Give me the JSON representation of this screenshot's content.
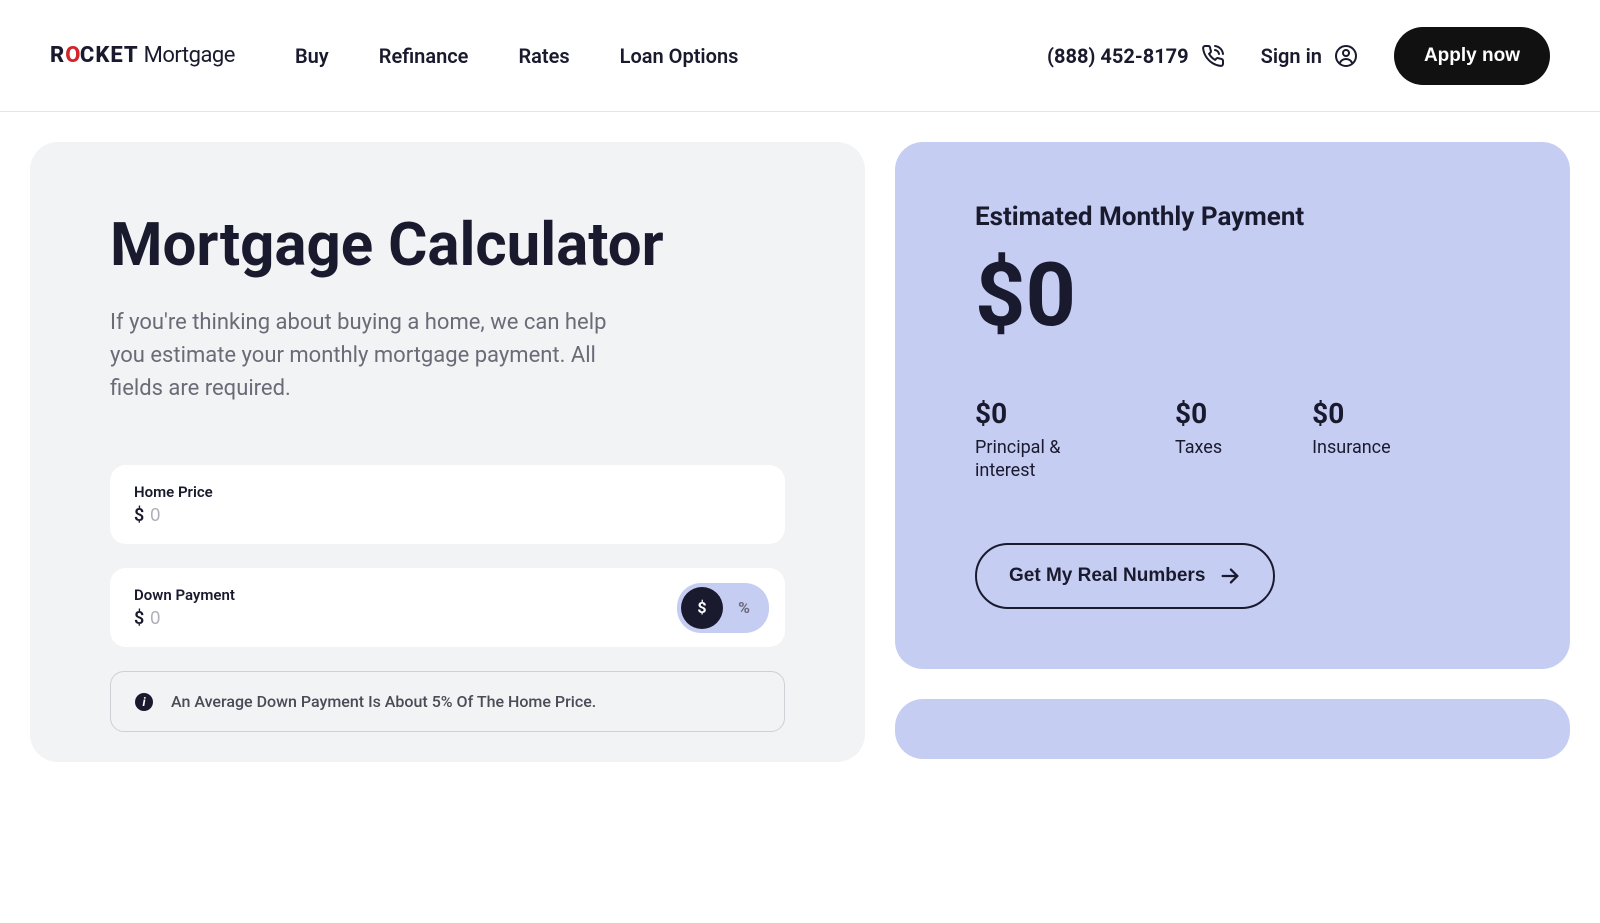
{
  "header": {
    "logo": {
      "brand": "R",
      "brand_o": "O",
      "brand_rest": "CKET",
      "product": "Mortgage"
    },
    "nav": [
      "Buy",
      "Refinance",
      "Rates",
      "Loan Options"
    ],
    "phone": "(888) 452-8179",
    "signin": "Sign in",
    "apply": "Apply now"
  },
  "calculator": {
    "title": "Mortgage Calculator",
    "subtitle": "If you're thinking about buying a home, we can help you estimate your monthly mortgage payment. All fields are required.",
    "home_price": {
      "label": "Home Price",
      "placeholder": "0"
    },
    "down_payment": {
      "label": "Down Payment",
      "placeholder": "0",
      "toggle_dollar": "$",
      "toggle_percent": "%"
    },
    "info": "An Average Down Payment Is About 5% Of The Home Price."
  },
  "estimate": {
    "title": "Estimated Monthly Payment",
    "amount": "$0",
    "breakdown": [
      {
        "amount": "$0",
        "label": "Principal & interest"
      },
      {
        "amount": "$0",
        "label": "Taxes"
      },
      {
        "amount": "$0",
        "label": "Insurance"
      }
    ],
    "cta": "Get My Real Numbers"
  }
}
